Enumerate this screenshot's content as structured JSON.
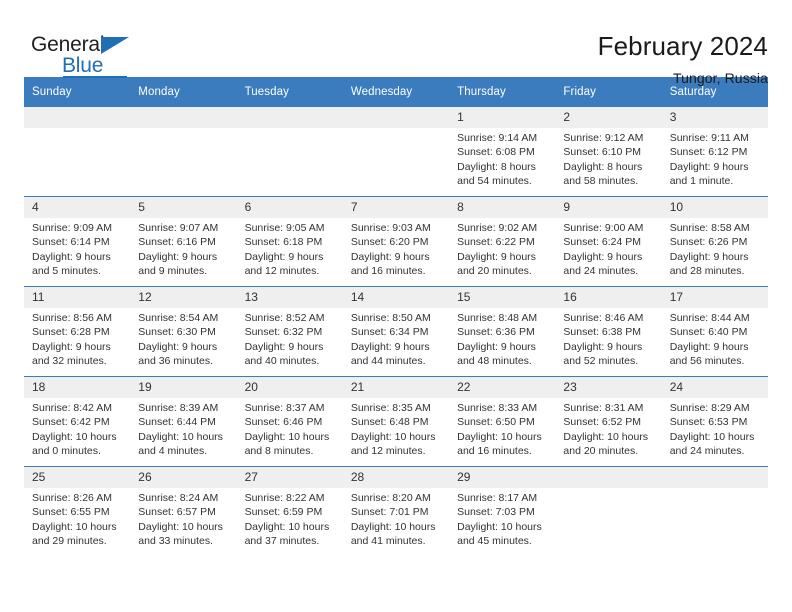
{
  "brand": {
    "name_part1": "General",
    "name_part2": "Blue",
    "accent_color": "#1f6fb5",
    "triangle_icon": "brand-triangle-icon"
  },
  "header": {
    "title": "February 2024",
    "subtitle": "Tungor, Russia"
  },
  "calendar": {
    "header_bg": "#3a7cbe",
    "daynum_bg": "#efefef",
    "weekday_headers": [
      "Sunday",
      "Monday",
      "Tuesday",
      "Wednesday",
      "Thursday",
      "Friday",
      "Saturday"
    ],
    "labels": {
      "sunrise": "Sunrise:",
      "sunset": "Sunset:",
      "daylight": "Daylight:"
    },
    "weeks": [
      [
        {
          "day": "",
          "empty": true
        },
        {
          "day": "",
          "empty": true
        },
        {
          "day": "",
          "empty": true
        },
        {
          "day": "",
          "empty": true
        },
        {
          "day": "1",
          "sunrise": "Sunrise: 9:14 AM",
          "sunset": "Sunset: 6:08 PM",
          "daylight": "Daylight: 8 hours and 54 minutes."
        },
        {
          "day": "2",
          "sunrise": "Sunrise: 9:12 AM",
          "sunset": "Sunset: 6:10 PM",
          "daylight": "Daylight: 8 hours and 58 minutes."
        },
        {
          "day": "3",
          "sunrise": "Sunrise: 9:11 AM",
          "sunset": "Sunset: 6:12 PM",
          "daylight": "Daylight: 9 hours and 1 minute."
        }
      ],
      [
        {
          "day": "4",
          "sunrise": "Sunrise: 9:09 AM",
          "sunset": "Sunset: 6:14 PM",
          "daylight": "Daylight: 9 hours and 5 minutes."
        },
        {
          "day": "5",
          "sunrise": "Sunrise: 9:07 AM",
          "sunset": "Sunset: 6:16 PM",
          "daylight": "Daylight: 9 hours and 9 minutes."
        },
        {
          "day": "6",
          "sunrise": "Sunrise: 9:05 AM",
          "sunset": "Sunset: 6:18 PM",
          "daylight": "Daylight: 9 hours and 12 minutes."
        },
        {
          "day": "7",
          "sunrise": "Sunrise: 9:03 AM",
          "sunset": "Sunset: 6:20 PM",
          "daylight": "Daylight: 9 hours and 16 minutes."
        },
        {
          "day": "8",
          "sunrise": "Sunrise: 9:02 AM",
          "sunset": "Sunset: 6:22 PM",
          "daylight": "Daylight: 9 hours and 20 minutes."
        },
        {
          "day": "9",
          "sunrise": "Sunrise: 9:00 AM",
          "sunset": "Sunset: 6:24 PM",
          "daylight": "Daylight: 9 hours and 24 minutes."
        },
        {
          "day": "10",
          "sunrise": "Sunrise: 8:58 AM",
          "sunset": "Sunset: 6:26 PM",
          "daylight": "Daylight: 9 hours and 28 minutes."
        }
      ],
      [
        {
          "day": "11",
          "sunrise": "Sunrise: 8:56 AM",
          "sunset": "Sunset: 6:28 PM",
          "daylight": "Daylight: 9 hours and 32 minutes."
        },
        {
          "day": "12",
          "sunrise": "Sunrise: 8:54 AM",
          "sunset": "Sunset: 6:30 PM",
          "daylight": "Daylight: 9 hours and 36 minutes."
        },
        {
          "day": "13",
          "sunrise": "Sunrise: 8:52 AM",
          "sunset": "Sunset: 6:32 PM",
          "daylight": "Daylight: 9 hours and 40 minutes."
        },
        {
          "day": "14",
          "sunrise": "Sunrise: 8:50 AM",
          "sunset": "Sunset: 6:34 PM",
          "daylight": "Daylight: 9 hours and 44 minutes."
        },
        {
          "day": "15",
          "sunrise": "Sunrise: 8:48 AM",
          "sunset": "Sunset: 6:36 PM",
          "daylight": "Daylight: 9 hours and 48 minutes."
        },
        {
          "day": "16",
          "sunrise": "Sunrise: 8:46 AM",
          "sunset": "Sunset: 6:38 PM",
          "daylight": "Daylight: 9 hours and 52 minutes."
        },
        {
          "day": "17",
          "sunrise": "Sunrise: 8:44 AM",
          "sunset": "Sunset: 6:40 PM",
          "daylight": "Daylight: 9 hours and 56 minutes."
        }
      ],
      [
        {
          "day": "18",
          "sunrise": "Sunrise: 8:42 AM",
          "sunset": "Sunset: 6:42 PM",
          "daylight": "Daylight: 10 hours and 0 minutes."
        },
        {
          "day": "19",
          "sunrise": "Sunrise: 8:39 AM",
          "sunset": "Sunset: 6:44 PM",
          "daylight": "Daylight: 10 hours and 4 minutes."
        },
        {
          "day": "20",
          "sunrise": "Sunrise: 8:37 AM",
          "sunset": "Sunset: 6:46 PM",
          "daylight": "Daylight: 10 hours and 8 minutes."
        },
        {
          "day": "21",
          "sunrise": "Sunrise: 8:35 AM",
          "sunset": "Sunset: 6:48 PM",
          "daylight": "Daylight: 10 hours and 12 minutes."
        },
        {
          "day": "22",
          "sunrise": "Sunrise: 8:33 AM",
          "sunset": "Sunset: 6:50 PM",
          "daylight": "Daylight: 10 hours and 16 minutes."
        },
        {
          "day": "23",
          "sunrise": "Sunrise: 8:31 AM",
          "sunset": "Sunset: 6:52 PM",
          "daylight": "Daylight: 10 hours and 20 minutes."
        },
        {
          "day": "24",
          "sunrise": "Sunrise: 8:29 AM",
          "sunset": "Sunset: 6:53 PM",
          "daylight": "Daylight: 10 hours and 24 minutes."
        }
      ],
      [
        {
          "day": "25",
          "sunrise": "Sunrise: 8:26 AM",
          "sunset": "Sunset: 6:55 PM",
          "daylight": "Daylight: 10 hours and 29 minutes."
        },
        {
          "day": "26",
          "sunrise": "Sunrise: 8:24 AM",
          "sunset": "Sunset: 6:57 PM",
          "daylight": "Daylight: 10 hours and 33 minutes."
        },
        {
          "day": "27",
          "sunrise": "Sunrise: 8:22 AM",
          "sunset": "Sunset: 6:59 PM",
          "daylight": "Daylight: 10 hours and 37 minutes."
        },
        {
          "day": "28",
          "sunrise": "Sunrise: 8:20 AM",
          "sunset": "Sunset: 7:01 PM",
          "daylight": "Daylight: 10 hours and 41 minutes."
        },
        {
          "day": "29",
          "sunrise": "Sunrise: 8:17 AM",
          "sunset": "Sunset: 7:03 PM",
          "daylight": "Daylight: 10 hours and 45 minutes."
        },
        {
          "day": "",
          "empty": true
        },
        {
          "day": "",
          "empty": true
        }
      ]
    ]
  }
}
